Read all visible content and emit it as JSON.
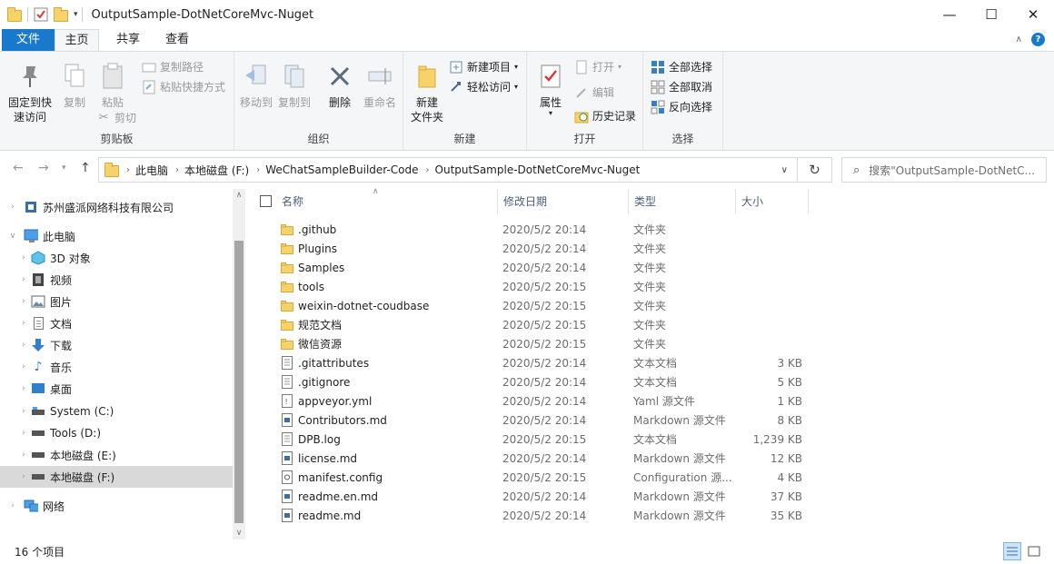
{
  "window": {
    "title": "OutputSample-DotNetCoreMvc-Nuget",
    "minimize": "—",
    "maximize": "☐",
    "close": "✕"
  },
  "tabs": {
    "file": "文件",
    "home": "主页",
    "share": "共享",
    "view": "查看"
  },
  "ribbon": {
    "clipboard": {
      "group_label": "剪贴板",
      "pin_line1": "固定到快",
      "pin_line2": "速访问",
      "copy": "复制",
      "paste": "粘贴",
      "copy_path": "复制路径",
      "paste_shortcut": "粘贴快捷方式",
      "cut": "剪切"
    },
    "organize": {
      "group_label": "组织",
      "move_to": "移动到",
      "copy_to": "复制到",
      "delete": "删除",
      "rename": "重命名"
    },
    "new": {
      "group_label": "新建",
      "new_folder_line1": "新建",
      "new_folder_line2": "文件夹",
      "new_item": "新建项目",
      "easy_access": "轻松访问"
    },
    "open": {
      "group_label": "打开",
      "properties": "属性",
      "open": "打开",
      "edit": "编辑",
      "history": "历史记录"
    },
    "select": {
      "group_label": "选择",
      "select_all": "全部选择",
      "select_none": "全部取消",
      "invert": "反向选择"
    }
  },
  "address": {
    "crumbs": [
      "此电脑",
      "本地磁盘 (F:)",
      "WeChatSampleBuilder-Code",
      "OutputSample-DotNetCoreMvc-Nuget"
    ],
    "search_placeholder": "搜索\"OutputSample-DotNetC..."
  },
  "sidebar": {
    "items": [
      {
        "label": "苏州盛派网络科技有限公司",
        "icon": "company-icon"
      },
      {
        "label": "此电脑",
        "icon": "computer-icon"
      },
      {
        "label": "3D 对象",
        "icon": "3d-objects-icon"
      },
      {
        "label": "视频",
        "icon": "video-icon"
      },
      {
        "label": "图片",
        "icon": "pictures-icon"
      },
      {
        "label": "文档",
        "icon": "documents-icon"
      },
      {
        "label": "下载",
        "icon": "download-icon"
      },
      {
        "label": "音乐",
        "icon": "music-icon"
      },
      {
        "label": "桌面",
        "icon": "desktop-icon"
      },
      {
        "label": "System (C:)",
        "icon": "system-drive-icon"
      },
      {
        "label": "Tools (D:)",
        "icon": "drive-icon"
      },
      {
        "label": "本地磁盘 (E:)",
        "icon": "drive-icon"
      },
      {
        "label": "本地磁盘 (F:)",
        "icon": "drive-icon"
      },
      {
        "label": "网络",
        "icon": "network-icon"
      }
    ]
  },
  "columns": {
    "name": "名称",
    "date": "修改日期",
    "type": "类型",
    "size": "大小"
  },
  "files": [
    {
      "name": ".github",
      "date": "2020/5/2 20:14",
      "type": "文件夹",
      "size": "",
      "kind": "folder"
    },
    {
      "name": "Plugins",
      "date": "2020/5/2 20:14",
      "type": "文件夹",
      "size": "",
      "kind": "folder"
    },
    {
      "name": "Samples",
      "date": "2020/5/2 20:14",
      "type": "文件夹",
      "size": "",
      "kind": "folder"
    },
    {
      "name": "tools",
      "date": "2020/5/2 20:15",
      "type": "文件夹",
      "size": "",
      "kind": "folder"
    },
    {
      "name": "weixin-dotnet-coudbase",
      "date": "2020/5/2 20:15",
      "type": "文件夹",
      "size": "",
      "kind": "folder"
    },
    {
      "name": "规范文档",
      "date": "2020/5/2 20:15",
      "type": "文件夹",
      "size": "",
      "kind": "folder"
    },
    {
      "name": "微信资源",
      "date": "2020/5/2 20:15",
      "type": "文件夹",
      "size": "",
      "kind": "folder"
    },
    {
      "name": ".gitattributes",
      "date": "2020/5/2 20:14",
      "type": "文本文档",
      "size": "3 KB",
      "kind": "doc"
    },
    {
      "name": ".gitignore",
      "date": "2020/5/2 20:14",
      "type": "文本文档",
      "size": "5 KB",
      "kind": "doc"
    },
    {
      "name": "appveyor.yml",
      "date": "2020/5/2 20:14",
      "type": "Yaml 源文件",
      "size": "1 KB",
      "kind": "yaml"
    },
    {
      "name": "Contributors.md",
      "date": "2020/5/2 20:14",
      "type": "Markdown 源文件",
      "size": "8 KB",
      "kind": "md"
    },
    {
      "name": "DPB.log",
      "date": "2020/5/2 20:15",
      "type": "文本文档",
      "size": "1,239 KB",
      "kind": "doc"
    },
    {
      "name": "license.md",
      "date": "2020/5/2 20:14",
      "type": "Markdown 源文件",
      "size": "12 KB",
      "kind": "md"
    },
    {
      "name": "manifest.config",
      "date": "2020/5/2 20:15",
      "type": "Configuration 源...",
      "size": "4 KB",
      "kind": "config"
    },
    {
      "name": "readme.en.md",
      "date": "2020/5/2 20:14",
      "type": "Markdown 源文件",
      "size": "37 KB",
      "kind": "md"
    },
    {
      "name": "readme.md",
      "date": "2020/5/2 20:14",
      "type": "Markdown 源文件",
      "size": "35 KB",
      "kind": "md"
    }
  ],
  "status": {
    "count": "16 个项目"
  },
  "colors": {
    "accent": "#1979ca",
    "folder": "#f6d26b",
    "selected_nav": "#d9d9d9"
  }
}
